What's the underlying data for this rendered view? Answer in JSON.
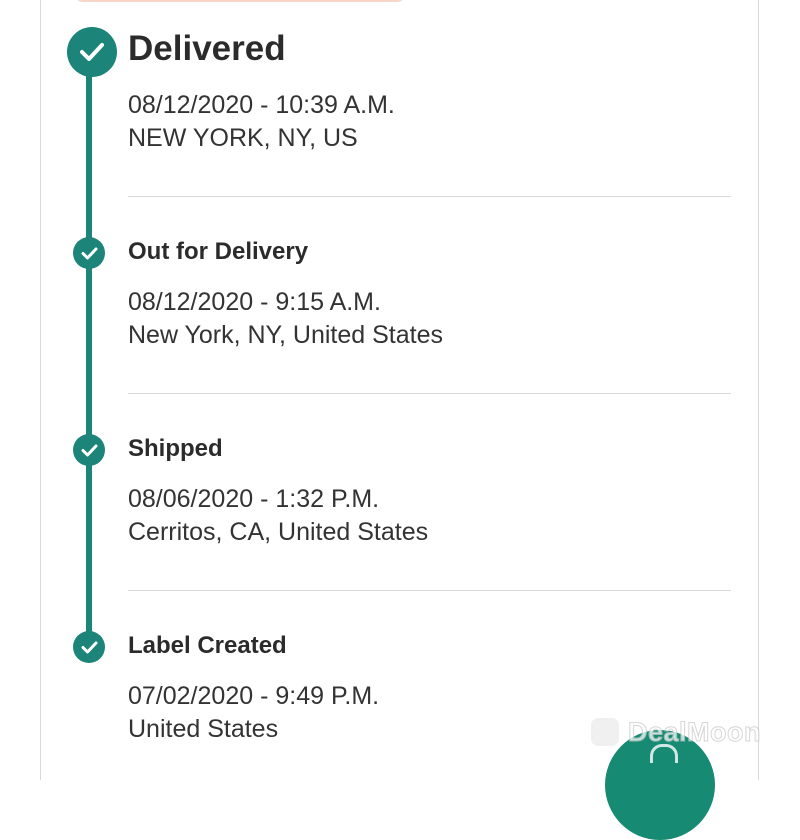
{
  "timeline": {
    "events": [
      {
        "status": "Delivered",
        "datetime": "08/12/2020 - 10:39 A.M.",
        "location": "NEW YORK, NY, US"
      },
      {
        "status": "Out for Delivery",
        "datetime": "08/12/2020 - 9:15 A.M.",
        "location": "New York, NY, United States"
      },
      {
        "status": "Shipped",
        "datetime": "08/06/2020 - 1:32 P.M.",
        "location": "Cerritos, CA, United States"
      },
      {
        "status": "Label Created",
        "datetime": "07/02/2020 - 9:49 P.M.",
        "location": "United States"
      }
    ]
  },
  "watermark": {
    "text": "DealMoon"
  },
  "colors": {
    "accent": "#1c8479",
    "fab": "#168a73",
    "divider": "#d9d9d9"
  },
  "icons": {
    "step": "check-circle-icon",
    "fab": "chat-icon"
  }
}
